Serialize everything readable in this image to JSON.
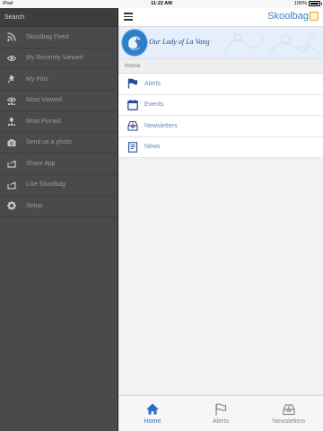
{
  "status_bar": {
    "carrier": "iPad",
    "time": "11:22 AM",
    "battery": "100%"
  },
  "sidebar": {
    "search_label": "Search",
    "items": [
      {
        "label": "Skoolbag Feed",
        "icon": "rss-icon"
      },
      {
        "label": "My Recently Viewed",
        "icon": "eye-icon"
      },
      {
        "label": "My Pins",
        "icon": "pin-icon"
      },
      {
        "label": "Most Viewed",
        "icon": "eye-chart-icon"
      },
      {
        "label": "Most Pinned",
        "icon": "pin-chart-icon"
      },
      {
        "label": "Send us a photo",
        "icon": "camera-icon"
      },
      {
        "label": "Share App",
        "icon": "share-icon"
      },
      {
        "label": "Like Skoolbag",
        "icon": "share-icon"
      },
      {
        "label": "Setup",
        "icon": "gear-icon"
      }
    ]
  },
  "header": {
    "brand": "Skoolbag"
  },
  "school": {
    "name": "Our Lady of La Vang"
  },
  "breadcrumb": "Home",
  "main_list": [
    {
      "label": "Alerts",
      "icon": "flag-icon"
    },
    {
      "label": "Events",
      "icon": "calendar-icon"
    },
    {
      "label": "Newsletters",
      "icon": "inbox-icon"
    },
    {
      "label": "News",
      "icon": "document-icon"
    }
  ],
  "tabbar": [
    {
      "label": "Home",
      "icon": "home-icon",
      "active": true
    },
    {
      "label": "Alerts",
      "icon": "flag-icon",
      "active": false
    },
    {
      "label": "Newsletters",
      "icon": "inbox-icon",
      "active": false
    }
  ],
  "colors": {
    "sidebar_bg": "#4a4a4a",
    "accent": "#2e6bc4",
    "list_text": "#6b86b8",
    "banner_bg": "#e6eefb"
  }
}
